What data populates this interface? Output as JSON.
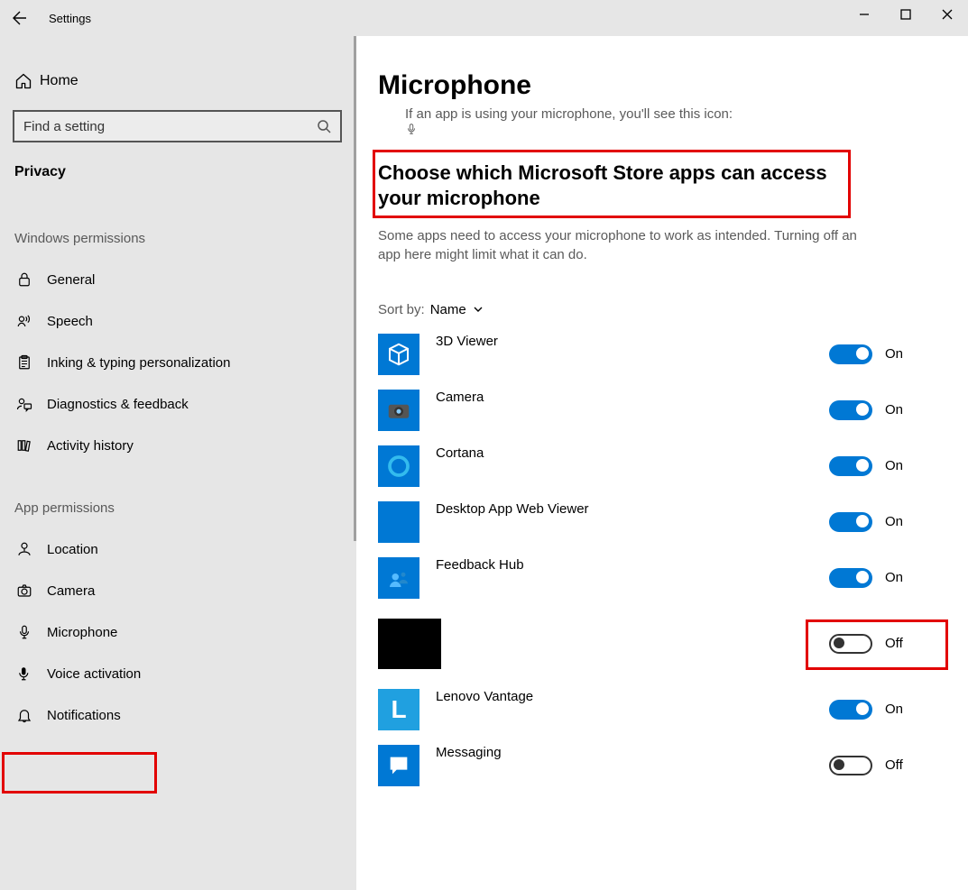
{
  "window": {
    "title": "Settings"
  },
  "sidebar": {
    "home_label": "Home",
    "search_placeholder": "Find a setting",
    "current_section": "Privacy",
    "groups": [
      {
        "label": "Windows permissions",
        "items": [
          {
            "icon": "lock-icon",
            "label": "General"
          },
          {
            "icon": "speech-icon",
            "label": "Speech"
          },
          {
            "icon": "clipboard-icon",
            "label": "Inking & typing personalization"
          },
          {
            "icon": "feedback-icon",
            "label": "Diagnostics & feedback"
          },
          {
            "icon": "history-icon",
            "label": "Activity history"
          }
        ]
      },
      {
        "label": "App permissions",
        "items": [
          {
            "icon": "location-icon",
            "label": "Location"
          },
          {
            "icon": "camera-icon",
            "label": "Camera"
          },
          {
            "icon": "microphone-icon",
            "label": "Microphone",
            "highlighted": true
          },
          {
            "icon": "voice-icon",
            "label": "Voice activation"
          },
          {
            "icon": "bell-icon",
            "label": "Notifications"
          }
        ]
      }
    ]
  },
  "main": {
    "page_title": "Microphone",
    "truncated_hint": "If an app is using your microphone, you'll see this icon:",
    "section_heading": "Choose which Microsoft Store apps can access your microphone",
    "section_desc": "Some apps need to access your microphone to work as intended. Turning off an app here might limit what it can do.",
    "sort_label": "Sort by:",
    "sort_value": "Name",
    "apps": [
      {
        "name": "3D Viewer",
        "icon_bg": "#0078d4",
        "icon": "cube",
        "state": "On"
      },
      {
        "name": "Camera",
        "icon_bg": "#0078d4",
        "icon": "camera",
        "state": "On"
      },
      {
        "name": "Cortana",
        "icon_bg": "#0078d4",
        "icon": "ring",
        "state": "On"
      },
      {
        "name": "Desktop App Web Viewer",
        "icon_bg": "#0078d4",
        "icon": "blank",
        "state": "On"
      },
      {
        "name": "Feedback Hub",
        "icon_bg": "#0078d4",
        "icon": "person",
        "state": "On"
      },
      {
        "name": "",
        "icon_bg": "#000000",
        "icon": "blank",
        "large": true,
        "state": "Off",
        "highlighted": true
      },
      {
        "name": "Lenovo Vantage",
        "icon_bg": "#20a0e0",
        "icon": "L",
        "state": "On"
      },
      {
        "name": "Messaging",
        "icon_bg": "#0078d4",
        "icon": "chat",
        "state": "Off"
      }
    ]
  }
}
